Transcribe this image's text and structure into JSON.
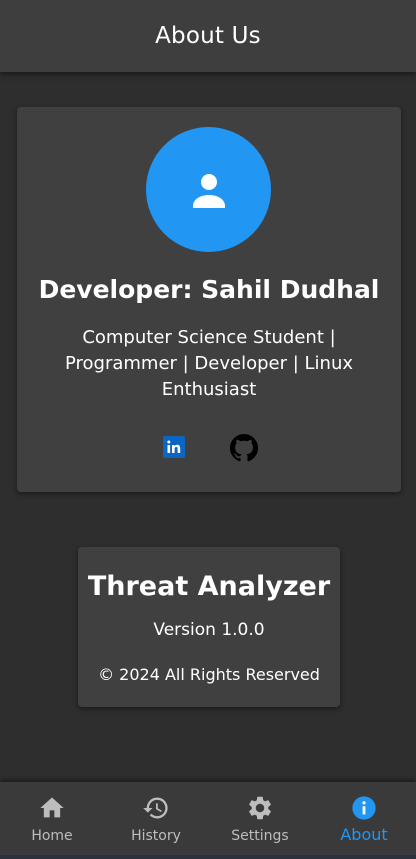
{
  "app_bar": {
    "title": "About Us"
  },
  "developer_card": {
    "avatar_icon": "person-icon",
    "name": "Developer: Sahil Dudhal",
    "description": "Computer Science Student | Programmer | Developer | Linux Enthusiast",
    "links": [
      {
        "icon": "linkedin-icon"
      },
      {
        "icon": "github-icon"
      }
    ]
  },
  "app_info_card": {
    "name": "Threat Analyzer",
    "version": "Version 1.0.0",
    "copyright": "© 2024 All Rights Reserved"
  },
  "bottom_nav": {
    "items": [
      {
        "label": "Home",
        "icon": "home-icon",
        "active": false
      },
      {
        "label": "History",
        "icon": "history-icon",
        "active": false
      },
      {
        "label": "Settings",
        "icon": "gear-icon",
        "active": false
      },
      {
        "label": "About",
        "icon": "info-icon",
        "active": true
      }
    ]
  },
  "colors": {
    "background": "#2e2e2e",
    "card": "#404040",
    "accent": "#2196f3",
    "inactive_nav": "#bdbdbd"
  }
}
